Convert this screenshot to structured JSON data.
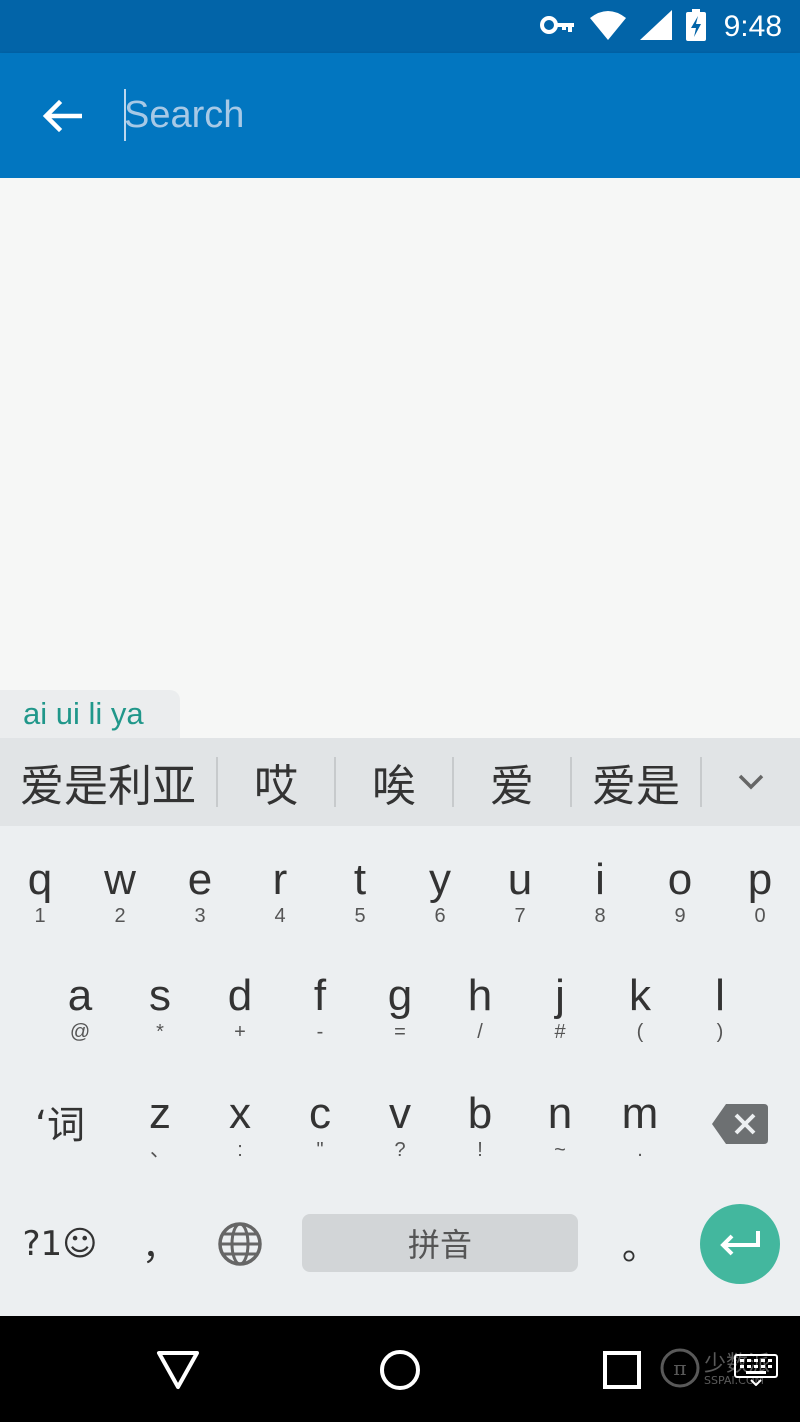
{
  "status_bar": {
    "time": "9:48",
    "icons": [
      "vpn-key-icon",
      "wifi-icon",
      "signal-icon",
      "battery-charging-icon"
    ]
  },
  "app_bar": {
    "back_icon": "arrow-left-icon",
    "search_placeholder": "Search"
  },
  "ime": {
    "composing_text": "ai ui li ya",
    "candidates": [
      "爱是利亚",
      "哎",
      "唉",
      "爱",
      "爱是"
    ],
    "more_icon": "chevron-down-icon",
    "rows": [
      [
        {
          "main": "q",
          "sub": "1"
        },
        {
          "main": "w",
          "sub": "2"
        },
        {
          "main": "e",
          "sub": "3"
        },
        {
          "main": "r",
          "sub": "4"
        },
        {
          "main": "t",
          "sub": "5"
        },
        {
          "main": "y",
          "sub": "6"
        },
        {
          "main": "u",
          "sub": "7"
        },
        {
          "main": "i",
          "sub": "8"
        },
        {
          "main": "o",
          "sub": "9"
        },
        {
          "main": "p",
          "sub": "0"
        }
      ],
      [
        {
          "main": "a",
          "sub": "@"
        },
        {
          "main": "s",
          "sub": "*"
        },
        {
          "main": "d",
          "sub": "+"
        },
        {
          "main": "f",
          "sub": "-"
        },
        {
          "main": "g",
          "sub": "="
        },
        {
          "main": "h",
          "sub": "/"
        },
        {
          "main": "j",
          "sub": "#"
        },
        {
          "main": "k",
          "sub": "("
        },
        {
          "main": "l",
          "sub": ")"
        }
      ],
      [
        {
          "main": "z",
          "sub": "、"
        },
        {
          "main": "x",
          "sub": ":"
        },
        {
          "main": "c",
          "sub": "\""
        },
        {
          "main": "v",
          "sub": "?"
        },
        {
          "main": "b",
          "sub": "!"
        },
        {
          "main": "n",
          "sub": "~"
        },
        {
          "main": "m",
          "sub": "."
        }
      ]
    ],
    "word_key": "‘词",
    "symbols_key": "?1☺",
    "comma_key": "，",
    "globe_icon": "globe-icon",
    "space_label": "拼音",
    "period_key": "。",
    "backspace_icon": "backspace-icon",
    "enter_icon": "enter-icon",
    "colors": {
      "accent": "#43b79e",
      "composing": "#20978a",
      "app_bar": "#0276c0",
      "status_bar": "#0264a8"
    }
  },
  "nav_bar": {
    "icons": [
      "back-triangle-icon",
      "home-circle-icon",
      "recents-square-icon",
      "keyboard-icon"
    ]
  },
  "watermark": {
    "main": "少数派",
    "sub": "SSPAI.COM"
  }
}
